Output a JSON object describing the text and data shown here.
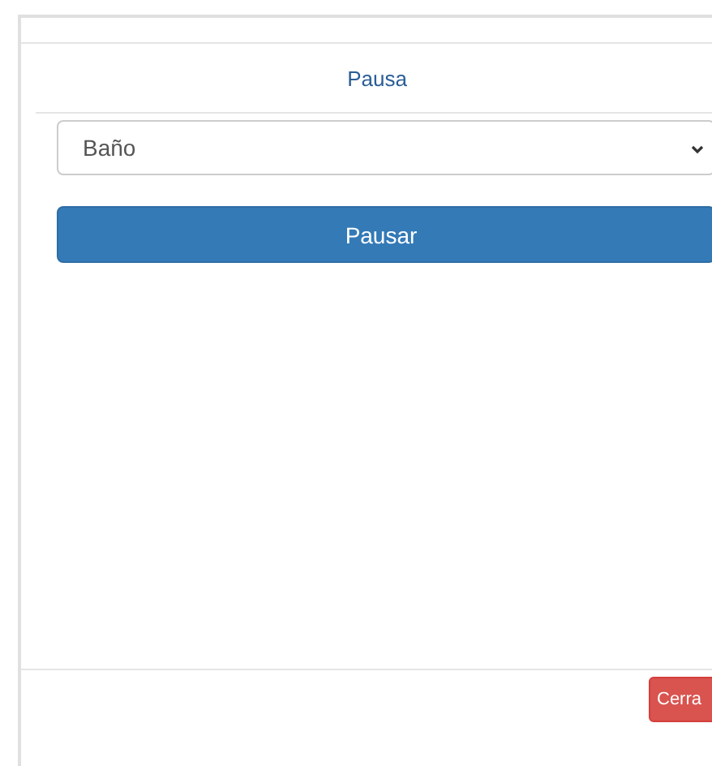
{
  "modal": {
    "title": "Pausa",
    "select": {
      "value": "Baño"
    },
    "primary_button": "Pausar",
    "footer_button": "Cerra"
  }
}
